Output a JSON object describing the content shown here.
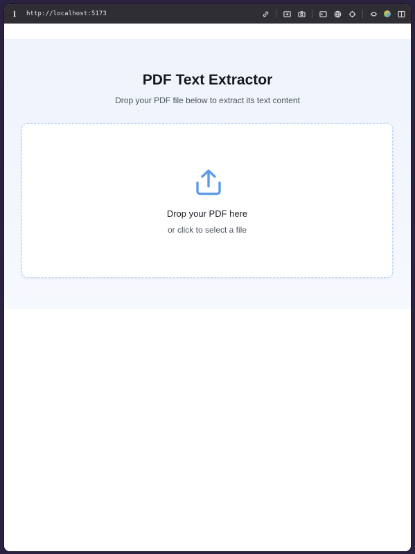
{
  "browser": {
    "url": "http://localhost:5173",
    "icons": [
      "info-icon",
      "link-icon",
      "screenshot-icon",
      "camera-icon",
      "terminal-icon",
      "globe-icon",
      "crosshair-icon",
      "extensions-icon",
      "profile-icon",
      "split-view-icon"
    ]
  },
  "page": {
    "title": "PDF Text Extractor",
    "subtitle": "Drop your PDF file below to extract its text content"
  },
  "dropzone": {
    "label": "Drop your PDF here",
    "sublabel": "or click to select a file",
    "icon": "upload-icon",
    "accent": "#5e9ae8"
  }
}
